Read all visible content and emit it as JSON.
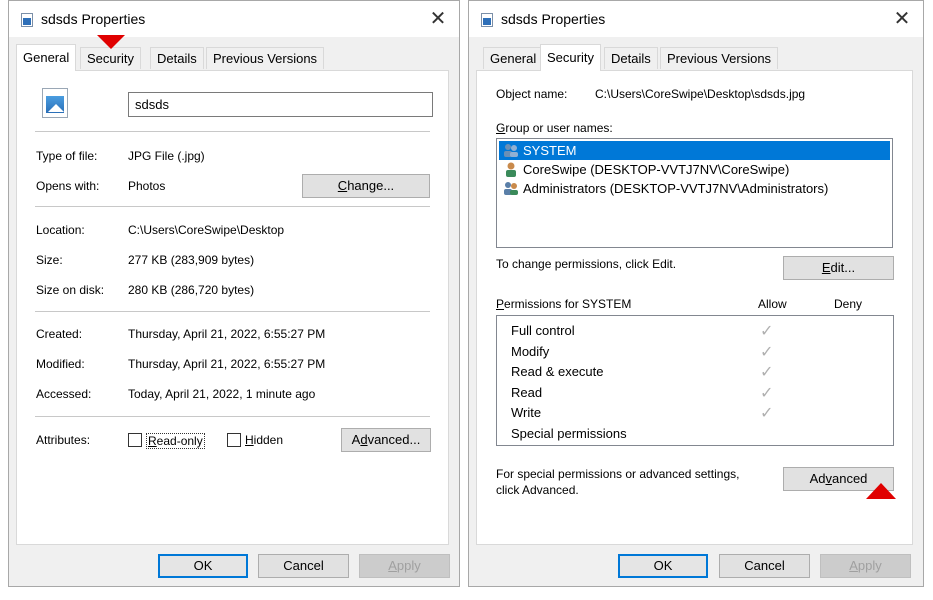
{
  "left": {
    "title": "sdsds Properties",
    "close": "✕",
    "tabs": [
      "General",
      "Security",
      "Details",
      "Previous Versions"
    ],
    "active_tab": "General",
    "filename": "sdsds",
    "type_label": "Type of file:",
    "type_value": "JPG File (.jpg)",
    "opens_label": "Opens with:",
    "opens_value": "Photos",
    "change_button": "Change...",
    "location_label": "Location:",
    "location_value": "C:\\Users\\CoreSwipe\\Desktop",
    "size_label": "Size:",
    "size_value": "277 KB (283,909 bytes)",
    "size_disk_label": "Size on disk:",
    "size_disk_value": "280 KB (286,720 bytes)",
    "created_label": "Created:",
    "created_value": "Thursday, April 21, 2022, 6:55:27 PM",
    "modified_label": "Modified:",
    "modified_value": "Thursday, April 21, 2022, 6:55:27 PM",
    "accessed_label": "Accessed:",
    "accessed_value": "Today, April 21, 2022, 1 minute ago",
    "attributes_label": "Attributes:",
    "readonly_label": "Read-only",
    "hidden_label": "Hidden",
    "advanced_button": "Advanced...",
    "ok": "OK",
    "cancel": "Cancel",
    "apply": "Apply"
  },
  "right": {
    "title": "sdsds Properties",
    "close": "✕",
    "tabs": [
      "General",
      "Security",
      "Details",
      "Previous Versions"
    ],
    "active_tab": "Security",
    "object_name_label": "Object name:",
    "object_name_value": "C:\\Users\\CoreSwipe\\Desktop\\sdsds.jpg",
    "group_label": "Group or user names:",
    "users": [
      "SYSTEM",
      "CoreSwipe (DESKTOP-VVTJ7NV\\CoreSwipe)",
      "Administrators (DESKTOP-VVTJ7NV\\Administrators)"
    ],
    "change_perm_text": "To change permissions, click Edit.",
    "edit_button": "Edit...",
    "perm_for_label": "Permissions for SYSTEM",
    "allow_label": "Allow",
    "deny_label": "Deny",
    "permissions": [
      "Full control",
      "Modify",
      "Read & execute",
      "Read",
      "Write",
      "Special permissions"
    ],
    "allowed": [
      true,
      true,
      true,
      true,
      true,
      false
    ],
    "special_text_1": "For special permissions or advanced settings,",
    "special_text_2": "click Advanced.",
    "advanced_button": "Advanced",
    "ok": "OK",
    "cancel": "Cancel",
    "apply": "Apply"
  },
  "colors": {
    "selection": "#0078d7",
    "annotation_arrow": "#e00000"
  }
}
